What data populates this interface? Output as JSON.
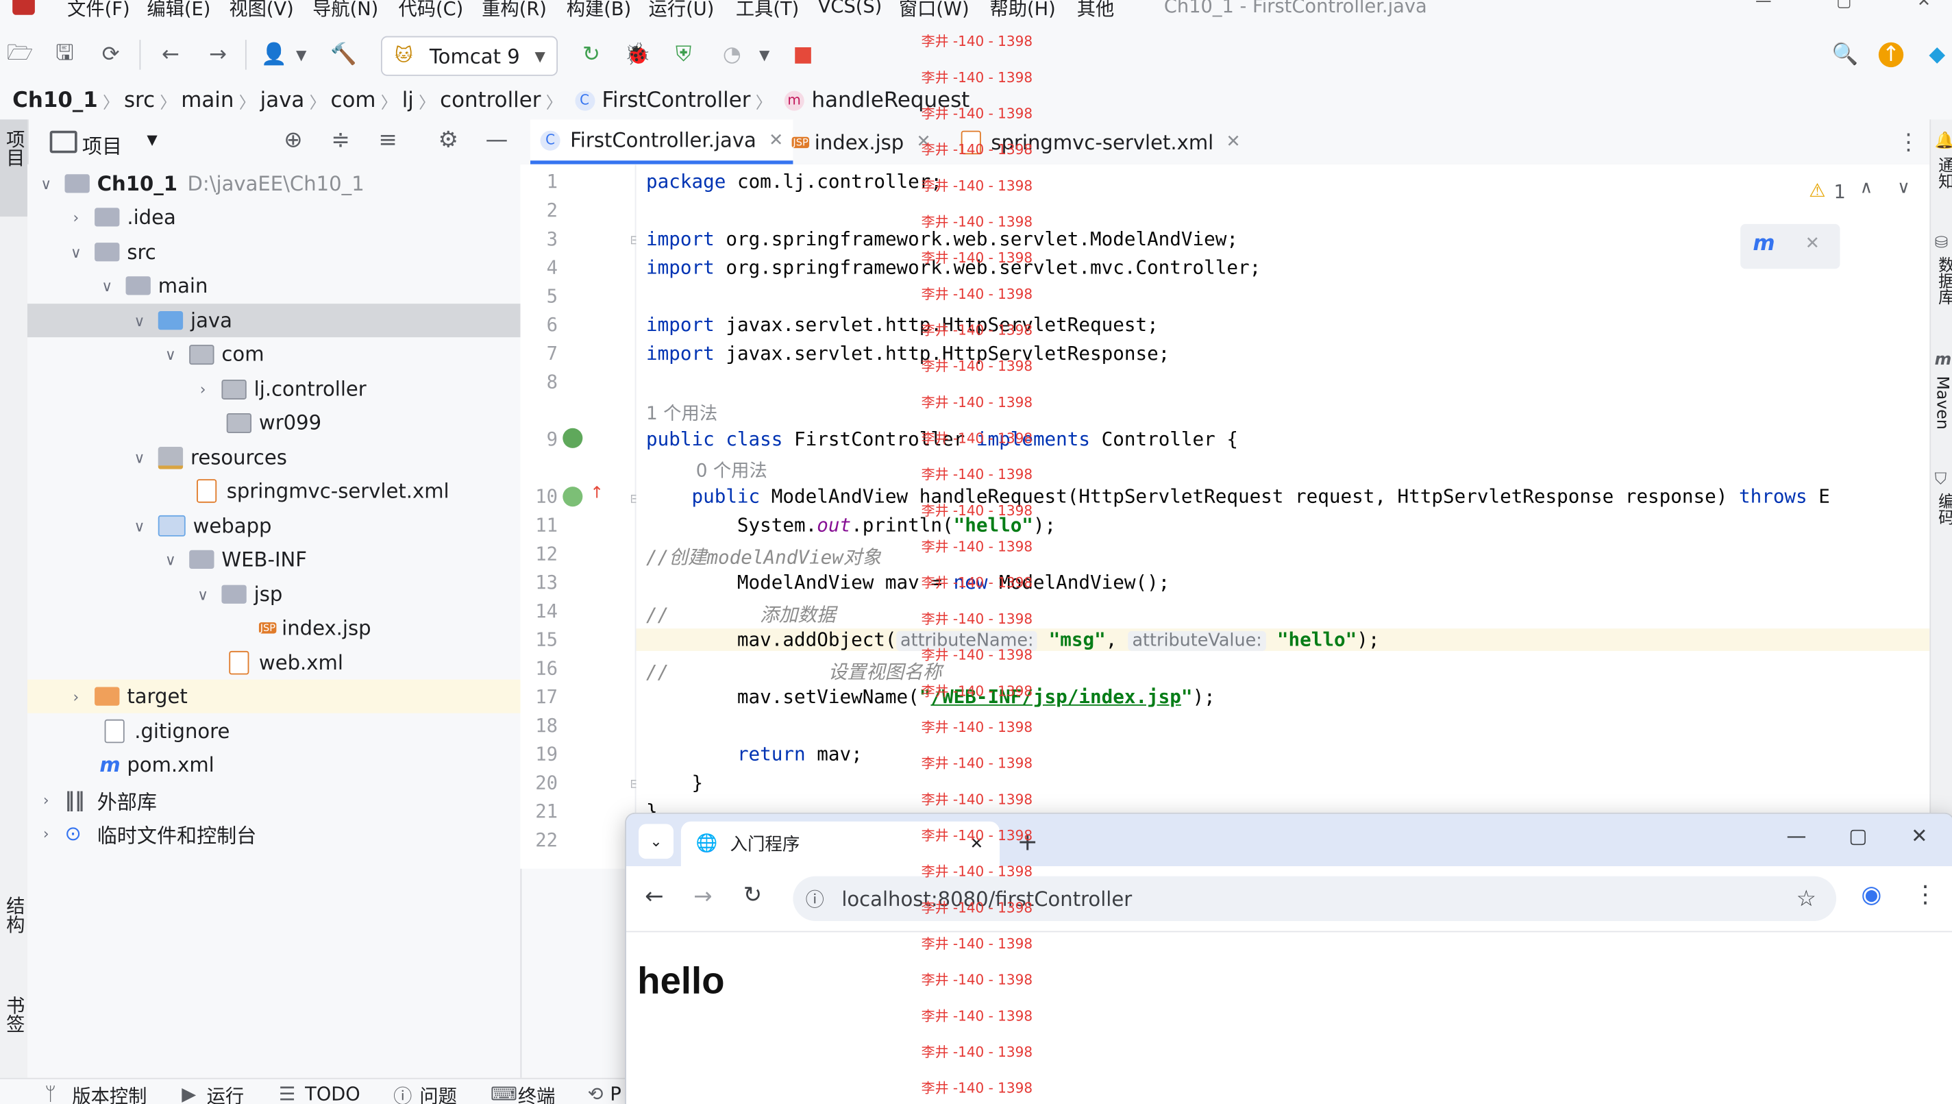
{
  "menubar": {
    "items": [
      "文件(F)",
      "编辑(E)",
      "视图(V)",
      "导航(N)",
      "代码(C)",
      "重构(R)",
      "构建(B)",
      "运行(U)",
      "工具(T)",
      "VCS(S)",
      "窗口(W)",
      "帮助(H)",
      "其他"
    ],
    "window_title": "Ch10_1 - FirstController.java"
  },
  "toolbar": {
    "run_config": "Tomcat 9"
  },
  "breadcrumb": {
    "items": [
      "Ch10_1",
      "src",
      "main",
      "java",
      "com",
      "lj",
      "controller",
      "FirstController",
      "handleRequest"
    ]
  },
  "left_strip": {
    "project": "项目",
    "structure": "结构",
    "bookmarks": "书签"
  },
  "project_panel": {
    "title": "项目",
    "tree": [
      {
        "label": "Ch10_1",
        "extra": "D:\\javaEE\\Ch10_1"
      },
      {
        "label": ".idea"
      },
      {
        "label": "src"
      },
      {
        "label": "main"
      },
      {
        "label": "java"
      },
      {
        "label": "com"
      },
      {
        "label": "lj.controller"
      },
      {
        "label": "wr099"
      },
      {
        "label": "resources"
      },
      {
        "label": "springmvc-servlet.xml"
      },
      {
        "label": "webapp"
      },
      {
        "label": "WEB-INF"
      },
      {
        "label": "jsp"
      },
      {
        "label": "index.jsp"
      },
      {
        "label": "web.xml"
      },
      {
        "label": "target"
      },
      {
        "label": ".gitignore"
      },
      {
        "label": "pom.xml"
      },
      {
        "label": "外部库"
      },
      {
        "label": "临时文件和控制台"
      }
    ]
  },
  "editor": {
    "tabs": [
      {
        "label": "FirstController.java"
      },
      {
        "label": "index.jsp"
      },
      {
        "label": "springmvc-servlet.xml"
      }
    ],
    "line_numbers": [
      "1",
      "2",
      "3",
      "4",
      "5",
      "6",
      "7",
      "8",
      "9",
      "10",
      "11",
      "12",
      "13",
      "14",
      "15",
      "16",
      "17",
      "18",
      "19",
      "20",
      "21",
      "22"
    ],
    "usage_class": "1 个用法",
    "usage_method": "0 个用法",
    "warning_count": "1",
    "code": {
      "l1_kw": "package",
      "l1_rest": " com.lj.controller;",
      "l3_kw": "import",
      "l3_rest": " org.springframework.web.servlet.ModelAndView;",
      "l4_kw": "import",
      "l4_rest": " org.springframework.web.servlet.mvc.Controller;",
      "l6_kw": "import",
      "l6_rest": " javax.servlet.http.HttpServletRequest;",
      "l7_kw": "import",
      "l7_rest": " javax.servlet.http.HttpServletResponse;",
      "l9_a": "public class",
      "l9_b": " FirstController ",
      "l9_c": "implements",
      "l9_d": " Controller {",
      "l10_a": "    public",
      "l10_b": " ModelAndView handleRequest(HttpServletRequest request, HttpServletResponse response) ",
      "l10_c": "throws",
      "l10_d": " E",
      "l11_a": "        System.",
      "l11_b": "out",
      "l11_c": ".println(",
      "l11_d": "\"hello\"",
      "l11_e": ");",
      "l12": "//创建modelAndView对象",
      "l13_a": "        ModelAndView mav = ",
      "l13_b": "new",
      "l13_c": " ModelAndView();",
      "l14": "//        添加数据",
      "l15_a": "        mav.addObject(",
      "l15_h1": "attributeName:",
      "l15_s1": "\"msg\"",
      "l15_c": ", ",
      "l15_h2": "attributeValue:",
      "l15_s2": "\"hello\"",
      "l15_d": ");",
      "l16": "//              设置视图名称",
      "l17_a": "        mav.setViewName(",
      "l17_q1": "\"",
      "l17_s": "/WEB-INF/jsp/index.jsp",
      "l17_q2": "\"",
      "l17_b": ");",
      "l19_a": "        ",
      "l19_b": "return",
      "l19_c": " mav;",
      "l20": "    }",
      "l21": "}"
    }
  },
  "right_strip": {
    "notifications": "通知",
    "database": "数据库",
    "maven": "Maven",
    "coverage": "编码"
  },
  "statusbar": {
    "items": [
      "版本控制",
      "运行",
      "TODO",
      "问题",
      "终端",
      "P"
    ]
  },
  "browser": {
    "tab_title": "入门程序",
    "url": "localhost:8080/firstController",
    "body_text": "hello"
  },
  "watermark": {
    "text": "李井 -140 - 1398"
  },
  "colors": {
    "accent": "#3574f0",
    "keyword": "#0033b3",
    "string": "#067d17",
    "comment": "#8c8c8c",
    "watermark": "#e53935"
  }
}
